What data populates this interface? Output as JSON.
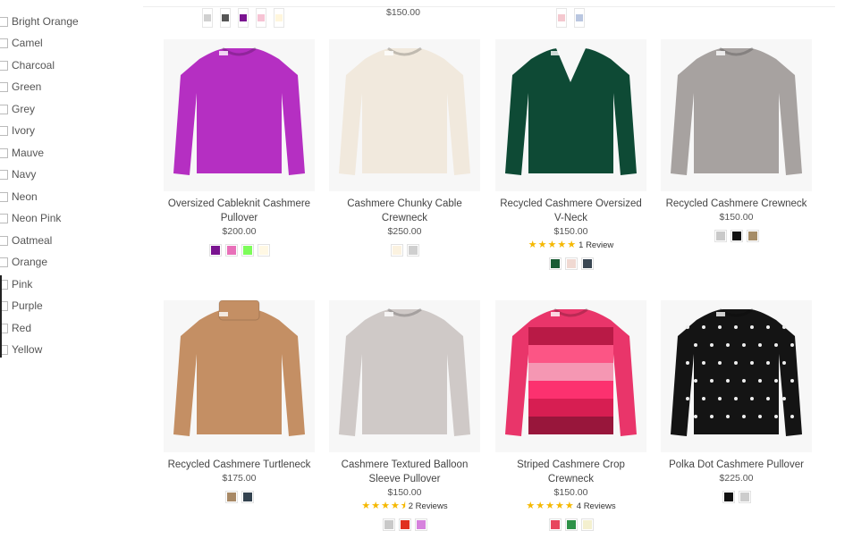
{
  "filters": {
    "colors": [
      "Bright Orange",
      "Camel",
      "Charcoal",
      "Green",
      "Grey",
      "Ivory",
      "Mauve",
      "Navy",
      "Neon",
      "Neon Pink",
      "Oatmeal",
      "Orange",
      "Pink",
      "Purple",
      "Red",
      "Yellow"
    ]
  },
  "top_row": {
    "price": "$150.00"
  },
  "products": [
    {
      "name": "Oversized Cableknit Cashmere Pullover",
      "price": "$200.00",
      "color": "#b52fc2",
      "swatches": [
        "#7a1490",
        "#e870b9",
        "#7dfc5a",
        "#fff8e4"
      ]
    },
    {
      "name": "Cashmere Chunky Cable Crewneck",
      "price": "$250.00",
      "color": "#f1e9dd",
      "swatches": [
        "#fbf2e0",
        "#cfcfcf"
      ]
    },
    {
      "name": "Recycled Cashmere Oversized V-Neck",
      "price": "$150.00",
      "color": "#0e4a35",
      "reviews": "1 Review",
      "rating": 5,
      "swatches": [
        "#195c34",
        "#f0d9d2",
        "#3a4753"
      ]
    },
    {
      "name": "Recycled Cashmere Crewneck",
      "price": "$150.00",
      "color": "#a7a2a0",
      "swatches": [
        "#c9c9c9",
        "#111111",
        "#a58c67"
      ]
    },
    {
      "name": "Recycled Cashmere Turtleneck",
      "price": "$175.00",
      "color": "#c48f64",
      "swatches": [
        "#a88966",
        "#33424f"
      ]
    },
    {
      "name": "Cashmere Textured Balloon Sleeve Pullover",
      "price": "$150.00",
      "color": "#cfc9c7",
      "reviews": "2 Reviews",
      "rating": 4.5,
      "swatches": [
        "#c9c9c9",
        "#e0301f",
        "#d682dd"
      ]
    },
    {
      "name": "Striped Cashmere Crop Crewneck",
      "price": "$150.00",
      "color": "#e9356a",
      "reviews": "4 Reviews",
      "rating": 5,
      "swatches": [
        "#e8475e",
        "#2e9248",
        "#f4f0cf"
      ]
    },
    {
      "name": "Polka Dot Cashmere Pullover",
      "price": "$225.00",
      "color": "#141414",
      "swatches": [
        "#111111",
        "#cccccc"
      ]
    }
  ]
}
